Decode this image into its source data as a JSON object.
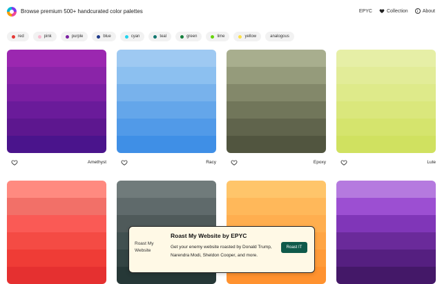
{
  "header": {
    "brand_text": "Browse premium 500+ handcurated color palettes",
    "nav": {
      "epyc": "EPYC",
      "collection": "Collection",
      "about": "About"
    }
  },
  "filters": [
    {
      "label": "red",
      "color": "#e53935"
    },
    {
      "label": "pink",
      "color": "#f8bbd0"
    },
    {
      "label": "purple",
      "color": "#7b1fa2"
    },
    {
      "label": "blue",
      "color": "#1e3a8a"
    },
    {
      "label": "cyan",
      "color": "#22d3ee"
    },
    {
      "label": "teal",
      "color": "#0f766e"
    },
    {
      "label": "green",
      "color": "#15803d"
    },
    {
      "label": "lime",
      "color": "#65d40a"
    },
    {
      "label": "yellow",
      "color": "#fde047"
    },
    {
      "label": "analogous",
      "color": ""
    }
  ],
  "palettes": [
    {
      "name": "Amethyst",
      "colors": [
        "#9b27b0",
        "#8a24a8",
        "#7b1fa2",
        "#6a1b9a",
        "#5d178f",
        "#4a148c"
      ]
    },
    {
      "name": "Racy",
      "colors": [
        "#9ec9f2",
        "#8cc0f0",
        "#78b2ec",
        "#64a6ea",
        "#519ae8",
        "#3f8fe6"
      ]
    },
    {
      "name": "Epoxy",
      "colors": [
        "#a8ae8e",
        "#959b7b",
        "#83886a",
        "#71765a",
        "#60644c",
        "#51553f"
      ]
    },
    {
      "name": "Lute",
      "colors": [
        "#e6efa6",
        "#e2ec98",
        "#deea8a",
        "#dae77c",
        "#d5e46d",
        "#d0e160"
      ]
    },
    {
      "name": "",
      "colors": [
        "#ff8a80",
        "#f27068",
        "#fa5a55",
        "#f44b44",
        "#ef3c36",
        "#e53030"
      ]
    },
    {
      "name": "",
      "colors": [
        "#707b7b",
        "#5f6a6b",
        "#4f5a5a",
        "#415050",
        "#334443",
        "#263837"
      ]
    },
    {
      "name": "",
      "colors": [
        "#ffc56a",
        "#ffb85a",
        "#ffae4f",
        "#ffa544",
        "#ff9b39",
        "#ff922f"
      ]
    },
    {
      "name": "",
      "colors": [
        "#b57adf",
        "#9c4fd2",
        "#8036b8",
        "#6a2a9a",
        "#551f80",
        "#441868"
      ]
    }
  ],
  "ad": {
    "image_alt": "Roast My Website",
    "title": "Roast My Website by EPYC",
    "text": "Get your enemy website roasted by Donald Trump, Narendra Modi, Sheldon Cooper, and more.",
    "button": "Roast IT"
  }
}
